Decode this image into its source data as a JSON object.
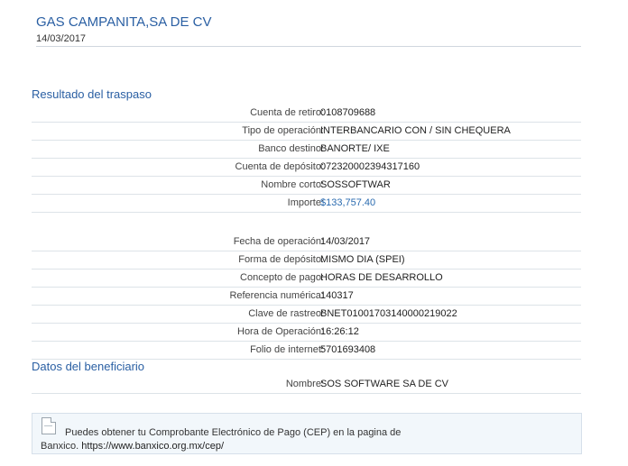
{
  "header": {
    "company": "GAS CAMPANITA,SA DE CV",
    "date": "14/03/2017"
  },
  "result": {
    "title": "Resultado del traspaso",
    "group1": [
      {
        "label": "Cuenta de retiro:",
        "value": "0108709688"
      },
      {
        "label": "Tipo de operación:",
        "value": "INTERBANCARIO CON / SIN CHEQUERA"
      },
      {
        "label": "Banco destino:",
        "value": "BANORTE/ IXE"
      },
      {
        "label": "Cuenta de depósito:",
        "value": "072320002394317160"
      },
      {
        "label": "Nombre corto:",
        "value": "SOSSOFTWAR"
      },
      {
        "label": "Importe:",
        "value": "$133,757.40"
      }
    ],
    "group2": [
      {
        "label": "Fecha de operación:",
        "value": "14/03/2017"
      },
      {
        "label": "Forma de depósito:",
        "value": "MISMO DIA (SPEI)"
      },
      {
        "label": "Concepto de pago:",
        "value": "HORAS DE DESARROLLO"
      },
      {
        "label": "Referencia numérica:",
        "value": "140317"
      },
      {
        "label": "Clave de rastreo:",
        "value": "BNET01001703140000219022"
      },
      {
        "label": "Hora de Operación:",
        "value": "16:26:12"
      },
      {
        "label": "Folio de internet:",
        "value": "5701693408"
      }
    ]
  },
  "beneficiary": {
    "title": "Datos del beneficiario",
    "rows": [
      {
        "label": "Nombre:",
        "value": "SOS SOFTWARE SA DE CV"
      }
    ]
  },
  "notice": {
    "line1": "Puedes obtener tu Comprobante Electrónico de Pago (CEP) en la pagina de",
    "line2_prefix": "Banxico.",
    "url": "https://www.banxico.org.mx/cep/"
  }
}
